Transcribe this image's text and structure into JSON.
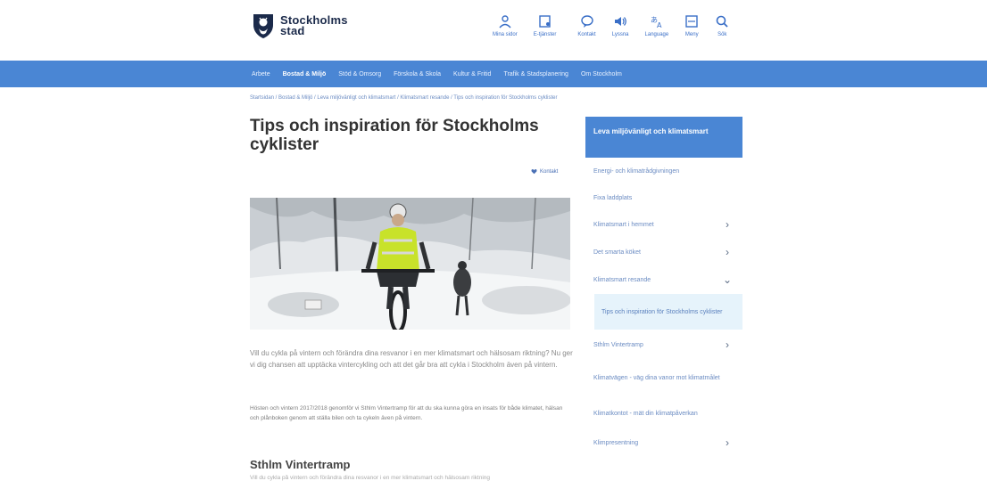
{
  "header": {
    "logo_line1": "Stockholms",
    "logo_line2": "stad",
    "icons": [
      {
        "name": "mina-sidor",
        "icon": "person-icon",
        "label": "Mina sidor"
      },
      {
        "name": "e-tjanster",
        "icon": "document-icon",
        "label": "E-tjänster"
      },
      {
        "name": "kontakt",
        "icon": "chat-icon",
        "label": "Kontakt"
      },
      {
        "name": "lyssna",
        "icon": "speaker-icon",
        "label": "Lyssna"
      },
      {
        "name": "language",
        "icon": "language-icon",
        "label": "Language"
      },
      {
        "name": "meny",
        "icon": "menu-icon",
        "label": "Meny"
      },
      {
        "name": "sok",
        "icon": "search-icon",
        "label": "Sök"
      }
    ]
  },
  "nav": {
    "items": [
      "Arbete",
      "Bostad & Miljö",
      "Stöd & Omsorg",
      "Förskola & Skola",
      "Kultur & Fritid",
      "Trafik & Stadsplanering",
      "Om Stockholm"
    ]
  },
  "breadcrumb": "Startsidan / Bostad & Miljö / Leva miljövänligt och klimatsmart / Klimatsmart resande / Tips och inspiration för Stockholms cyklister",
  "article": {
    "title": "Tips och inspiration för Stockholms cyklister",
    "contact_label": "Kontakt",
    "intro": "Vill du cykla på vintern och förändra dina resvanor i en mer klimatsmart och hälsosam riktning? Nu ger vi dig chansen att upptäcka vintercykling och att det går bra att cykla i Stockholm även på vintern.",
    "body": "Hösten och vintern 2017/2018 genomför vi Sthlm Vintertramp för att du ska kunna göra en insats för både klimatet, hälsan och plånboken genom att ställa bilen och ta cykeln även på vintern.",
    "section_heading": "Sthlm Vintertramp",
    "cut_text": "Vill du cykla på vintern och förändra dina resvanor i en mer klimatsmart och hälsosam riktning"
  },
  "sidebar": {
    "header": "Leva miljövänligt och klimatsmart",
    "items": [
      {
        "label": "Energi- och klimatrådgivningen",
        "chevron": "",
        "current": false
      },
      {
        "label": "Fixa laddplats",
        "chevron": "",
        "current": false
      },
      {
        "label": "Klimatsmart i hemmet",
        "chevron": "›",
        "current": false
      },
      {
        "label": "Det smarta köket",
        "chevron": "›",
        "current": false
      },
      {
        "label": "Klimatsmart resande",
        "chevron": "⌄",
        "current": false
      },
      {
        "label": "Tips och inspiration för Stockholms cyklister",
        "chevron": "",
        "current": true
      },
      {
        "label": "Sthlm Vintertramp",
        "chevron": "›",
        "current": false
      },
      {
        "label": "Klimatvägen - väg dina vanor mot klimatmålet",
        "chevron": "",
        "current": false
      },
      {
        "label": "Klimatkontot - mät din klimatpåverkan",
        "chevron": "",
        "current": false
      },
      {
        "label": "Klimpresentning",
        "chevron": "›",
        "current": false
      }
    ]
  },
  "colors": {
    "accent": "#4a86d4",
    "link": "#6a8bc2",
    "current_bg": "#e6f3fb"
  }
}
